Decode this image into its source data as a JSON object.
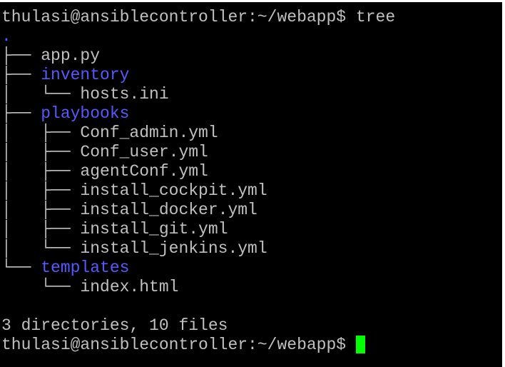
{
  "terminal": {
    "prompt": "thulasi@ansiblecontroller:~/webapp$",
    "command": "tree",
    "root": ".",
    "entries": [
      {
        "prefix": "├── ",
        "name": "app.py",
        "type": "file"
      },
      {
        "prefix": "├── ",
        "name": "inventory",
        "type": "dir"
      },
      {
        "prefix": "│   └── ",
        "name": "hosts.ini",
        "type": "file"
      },
      {
        "prefix": "├── ",
        "name": "playbooks",
        "type": "dir"
      },
      {
        "prefix": "│   ├── ",
        "name": "Conf_admin.yml",
        "type": "file"
      },
      {
        "prefix": "│   ├── ",
        "name": "Conf_user.yml",
        "type": "file"
      },
      {
        "prefix": "│   ├── ",
        "name": "agentConf.yml",
        "type": "file"
      },
      {
        "prefix": "│   ├── ",
        "name": "install_cockpit.yml",
        "type": "file"
      },
      {
        "prefix": "│   ├── ",
        "name": "install_docker.yml",
        "type": "file"
      },
      {
        "prefix": "│   ├── ",
        "name": "install_git.yml",
        "type": "file"
      },
      {
        "prefix": "│   └── ",
        "name": "install_jenkins.yml",
        "type": "file"
      },
      {
        "prefix": "└── ",
        "name": "templates",
        "type": "dir"
      },
      {
        "prefix": "    └── ",
        "name": "index.html",
        "type": "file"
      }
    ],
    "summary": "3 directories, 10 files",
    "colors": {
      "background": "#000000",
      "text": "#c0c0c0",
      "directory": "#5858ff",
      "cursor": "#00ff00"
    }
  }
}
